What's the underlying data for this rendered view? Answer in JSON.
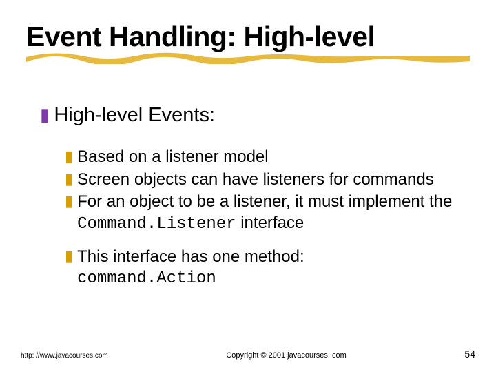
{
  "title": "Event Handling: High-level",
  "heading": "High-level Events:",
  "bullets": {
    "b1": "Based on a listener model",
    "b2": "Screen objects can have listeners for commands",
    "b3_pre": "For an object to be a listener, it must implement the ",
    "b3_code": "Command.Listener",
    "b3_post": " interface",
    "b4": "This interface has one method:",
    "b4_code": "command.Action"
  },
  "footer": {
    "url": "http: //www.javacourses.com",
    "copyright": "Copyright © 2001 javacourses. com",
    "page": "54"
  },
  "glyphs": {
    "z": "❚",
    "y": "❚"
  }
}
